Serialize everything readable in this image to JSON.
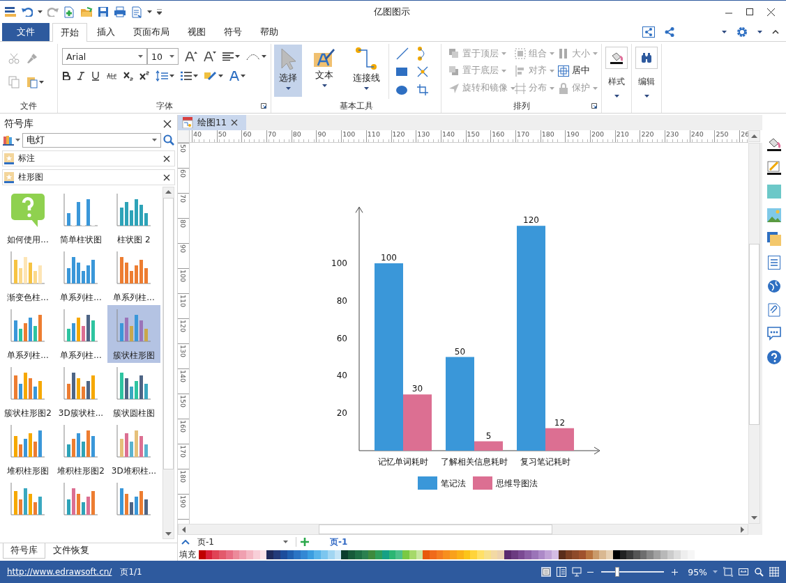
{
  "window": {
    "title": "亿图图示"
  },
  "menu_tabs": [
    {
      "label": "文件",
      "kind": "file",
      "selected": false
    },
    {
      "label": "开始",
      "kind": "tab",
      "selected": true
    },
    {
      "label": "插入",
      "kind": "tab",
      "selected": false
    },
    {
      "label": "页面布局",
      "kind": "tab",
      "selected": false
    },
    {
      "label": "视图",
      "kind": "tab",
      "selected": false
    },
    {
      "label": "符号",
      "kind": "tab",
      "selected": false
    },
    {
      "label": "帮助",
      "kind": "tab",
      "selected": false
    }
  ],
  "ribbon": {
    "groups": [
      {
        "kind": "clipboard",
        "label": "文件"
      },
      {
        "kind": "font",
        "label": "字体",
        "font": "Arial",
        "size": "10"
      },
      {
        "kind": "tools",
        "label": "基本工具",
        "tools": [
          {
            "label": "选择",
            "selected": true
          },
          {
            "label": "文本",
            "selected": false
          },
          {
            "label": "连接线",
            "selected": false
          }
        ]
      },
      {
        "kind": "arrange",
        "label": "排列",
        "commands": [
          {
            "label": "置于顶层",
            "disabled": true
          },
          {
            "label": "组合",
            "disabled": true
          },
          {
            "label": "大小",
            "disabled": true
          },
          {
            "label": "置于底层",
            "disabled": true
          },
          {
            "label": "对齐",
            "disabled": true
          },
          {
            "label": "居中",
            "disabled": false
          },
          {
            "label": "旋转和镜像",
            "disabled": true
          },
          {
            "label": "分布",
            "disabled": true
          },
          {
            "label": "保护",
            "disabled": true
          }
        ]
      },
      {
        "kind": "single",
        "label": "样式"
      },
      {
        "kind": "single",
        "label": "编辑"
      }
    ]
  },
  "library": {
    "title": "符号库",
    "search": {
      "value": "电灯"
    },
    "categories": [
      {
        "label": "标注"
      },
      {
        "label": "柱形图"
      }
    ],
    "items": [
      {
        "label": "如何使用...",
        "selected": false
      },
      {
        "label": "简单柱状图",
        "selected": false
      },
      {
        "label": "柱状图 2",
        "selected": false
      },
      {
        "label": "渐变色柱...",
        "selected": false
      },
      {
        "label": "单系列柱...",
        "selected": false
      },
      {
        "label": "单系列柱...",
        "selected": false
      },
      {
        "label": "单系列柱...",
        "selected": false
      },
      {
        "label": "单系列柱...",
        "selected": false
      },
      {
        "label": "簇状柱形图",
        "selected": true
      },
      {
        "label": "簇状柱形图2",
        "selected": false
      },
      {
        "label": "3D簇状柱...",
        "selected": false
      },
      {
        "label": "簇状圆柱图",
        "selected": false
      },
      {
        "label": "堆积柱形图",
        "selected": false
      },
      {
        "label": "堆积柱形图2",
        "selected": false
      },
      {
        "label": "3D堆积柱...",
        "selected": false
      },
      {
        "selected": false
      },
      {
        "selected": false
      },
      {
        "selected": false
      }
    ],
    "tabs": [
      {
        "label": "符号库",
        "selected": true
      },
      {
        "label": "文件恢复",
        "selected": false
      }
    ]
  },
  "document": {
    "tab": {
      "label": "绘图11"
    },
    "ruler": {
      "horizontal": [
        "40",
        "50",
        "60",
        "70",
        "80",
        "90",
        "100",
        "110",
        "120",
        "130",
        "140",
        "150",
        "160",
        "170",
        "180",
        "190",
        "200",
        "210",
        "220",
        "230",
        "240",
        "250",
        "26"
      ],
      "vertical": [
        "50",
        "60",
        "70",
        "80",
        "90",
        "100",
        "110",
        "120",
        "130",
        "140",
        "150",
        "160",
        "170",
        "180",
        "190"
      ]
    },
    "chart_data": {
      "type": "bar",
      "categories": [
        "记忆单词耗时",
        "了解相关信息耗时",
        "复习笔记耗时"
      ],
      "series": [
        {
          "name": "笔记法",
          "color": "#3a97d9",
          "values": [
            100,
            50,
            120
          ]
        },
        {
          "name": "思维导图法",
          "color": "#dc6f92",
          "values": [
            30,
            5,
            12
          ]
        }
      ],
      "yticks": [
        20,
        40,
        60,
        80,
        100
      ],
      "ylim": [
        0,
        130
      ],
      "data_labels": true,
      "legend": "bottom"
    }
  },
  "pages": {
    "current": "页-1",
    "tabs": [
      {
        "label": "页-1",
        "selected": true
      }
    ]
  },
  "fill_palette": {
    "label": "填充",
    "swatches": [
      {
        "color": "#c00000"
      },
      {
        "color": "#d9213a"
      },
      {
        "color": "#e04356"
      },
      {
        "color": "#e35a6c"
      },
      {
        "color": "#e86e84"
      },
      {
        "color": "#ec8a9a"
      },
      {
        "color": "#f0a0b0"
      },
      {
        "color": "#f4b8c4"
      },
      {
        "color": "#f8cfd8"
      },
      {
        "color": "#fbe3e9"
      },
      {
        "color": "#1f2a5c"
      },
      {
        "color": "#233a7a"
      },
      {
        "color": "#1c4d9c"
      },
      {
        "color": "#2060b0"
      },
      {
        "color": "#2a74c4"
      },
      {
        "color": "#3388d4"
      },
      {
        "color": "#3b9ee0"
      },
      {
        "color": "#58b4ea"
      },
      {
        "color": "#7cc6ef"
      },
      {
        "color": "#a2d6f2"
      },
      {
        "color": "#c4e4f6"
      },
      {
        "color": "#0b3d2e"
      },
      {
        "color": "#165a3a"
      },
      {
        "color": "#1d6e45"
      },
      {
        "color": "#2a8050"
      },
      {
        "color": "#3d8a3c"
      },
      {
        "color": "#2e9e5a"
      },
      {
        "color": "#16a085"
      },
      {
        "color": "#2bb673"
      },
      {
        "color": "#4cc08a"
      },
      {
        "color": "#7ac943"
      },
      {
        "color": "#a6d96a"
      },
      {
        "color": "#c8e6a0"
      },
      {
        "color": "#e8590c"
      },
      {
        "color": "#f06a1a"
      },
      {
        "color": "#f47c20"
      },
      {
        "color": "#f78f1e"
      },
      {
        "color": "#f9a11b"
      },
      {
        "color": "#fbb117"
      },
      {
        "color": "#fcc419"
      },
      {
        "color": "#ffd43b"
      },
      {
        "color": "#ffe066"
      },
      {
        "color": "#f7e08a"
      },
      {
        "color": "#f3d9a4"
      },
      {
        "color": "#ecd2b0"
      },
      {
        "color": "#5c2a6e"
      },
      {
        "color": "#6b3a80"
      },
      {
        "color": "#7b4a93"
      },
      {
        "color": "#8b5fa6"
      },
      {
        "color": "#9b74b8"
      },
      {
        "color": "#ad8ac8"
      },
      {
        "color": "#c0a2d6"
      },
      {
        "color": "#d4bce4"
      },
      {
        "color": "#5a2d1a"
      },
      {
        "color": "#7a3e22"
      },
      {
        "color": "#8e4a2a"
      },
      {
        "color": "#a0522d"
      },
      {
        "color": "#b8733f"
      },
      {
        "color": "#c99a6a"
      },
      {
        "color": "#d9b892"
      },
      {
        "color": "#e6d0b4"
      },
      {
        "color": "#000000"
      },
      {
        "color": "#222222"
      },
      {
        "color": "#3a3a3a"
      },
      {
        "color": "#555555"
      },
      {
        "color": "#6e6e6e"
      },
      {
        "color": "#888888"
      },
      {
        "color": "#a0a0a0"
      },
      {
        "color": "#b8b8b8"
      },
      {
        "color": "#cccccc"
      },
      {
        "color": "#dddddd"
      },
      {
        "color": "#eeeeee"
      },
      {
        "color": "#f6f6f6"
      }
    ]
  },
  "status_bar": {
    "link": "http://www.edrawsoft.cn/",
    "page": "页1/1",
    "zoom": {
      "level": 0.25,
      "reading": "95%"
    }
  }
}
